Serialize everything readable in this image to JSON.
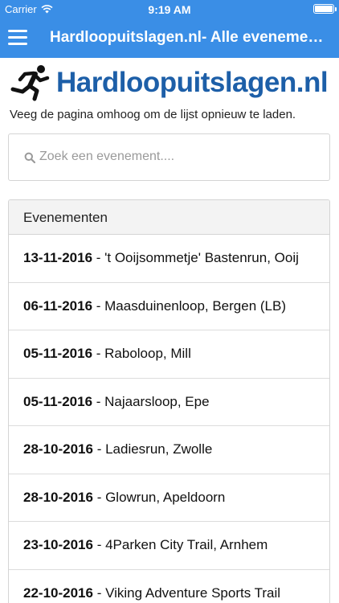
{
  "status_bar": {
    "carrier": "Carrier",
    "time": "9:19 AM"
  },
  "nav": {
    "title": "Hardloopuitslagen.nl- Alle evenementen"
  },
  "logo": {
    "text": "Hardloopuitslagen.nl"
  },
  "hint": "Veeg de pagina omhoog om de lijst opnieuw te laden.",
  "search": {
    "placeholder": "Zoek een evenement....",
    "value": ""
  },
  "list": {
    "header": "Evenementen",
    "items": [
      {
        "date": "13-11-2016",
        "name": " - 't Ooijsommetje' Bastenrun, Ooij"
      },
      {
        "date": "06-11-2016",
        "name": " - Maasduinenloop, Bergen (LB)"
      },
      {
        "date": "05-11-2016",
        "name": " - Raboloop, Mill"
      },
      {
        "date": "05-11-2016",
        "name": " - Najaarsloop, Epe"
      },
      {
        "date": "28-10-2016",
        "name": " - Ladiesrun, Zwolle"
      },
      {
        "date": "28-10-2016",
        "name": " - Glowrun, Apeldoorn"
      },
      {
        "date": "23-10-2016",
        "name": " - 4Parken City Trail, Arnhem"
      },
      {
        "date": "22-10-2016",
        "name": " - Viking Adventure Sports Trail"
      }
    ]
  },
  "colors": {
    "nav_background": "#3a8ee6",
    "logo_blue": "#1d5fa8"
  }
}
